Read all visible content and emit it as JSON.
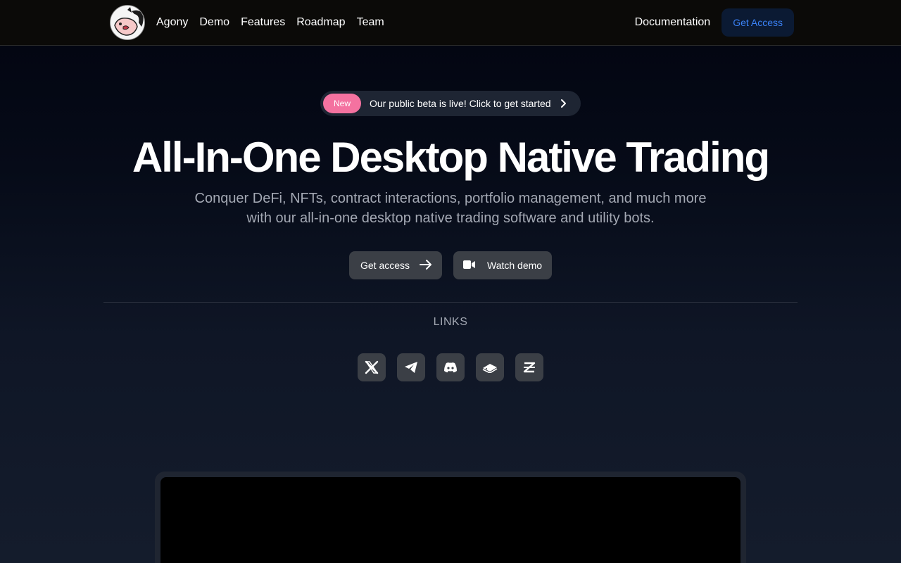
{
  "nav": {
    "links": [
      "Agony",
      "Demo",
      "Features",
      "Roadmap",
      "Team"
    ],
    "documentation": "Documentation",
    "get_access": "Get Access"
  },
  "badge": {
    "pill": "New",
    "text": "Our public beta is live! Click to get started"
  },
  "hero": {
    "title": "All-In-One Desktop Native Trading",
    "subtitle_line1": "Conquer DeFi, NFTs, contract interactions, portfolio management, and much more",
    "subtitle_line2": "with our all-in-one desktop native trading software and utility bots."
  },
  "cta": {
    "get_access": "Get access",
    "watch_demo": "Watch demo"
  },
  "links": {
    "label": "LINKS",
    "icons": [
      "x-twitter-icon",
      "telegram-icon",
      "discord-icon",
      "gitbook-icon",
      "linktree-icon"
    ]
  },
  "colors": {
    "badge_pill": "#f472a0",
    "nav_cta_text": "#3b82f6",
    "nav_cta_bg": "#0b1a33",
    "button_bg": "#3b3f46"
  }
}
